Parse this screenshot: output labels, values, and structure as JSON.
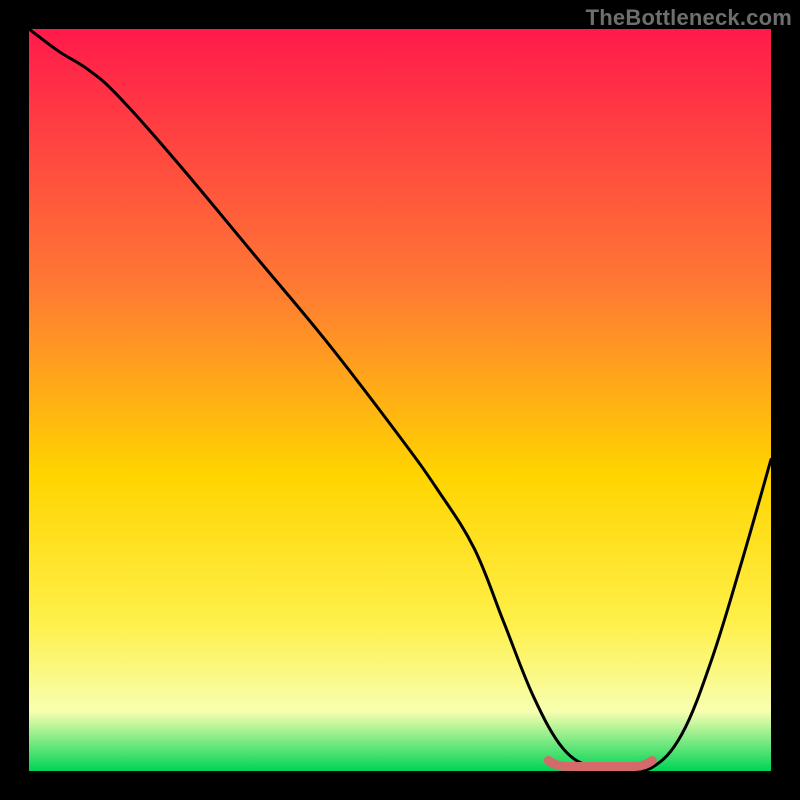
{
  "watermark": "TheBottleneck.com",
  "colors": {
    "gradient_top": "#ff1a4b",
    "gradient_mid1": "#ff7a33",
    "gradient_mid2": "#ffd400",
    "gradient_mid3": "#fff04a",
    "gradient_mid4": "#f7ffb0",
    "gradient_bottom": "#00d455",
    "curve": "#000000",
    "plateau": "#d46a6a",
    "frame": "#000000"
  },
  "chart_data": {
    "type": "line",
    "title": "",
    "xlabel": "",
    "ylabel": "",
    "xlim": [
      0,
      100
    ],
    "ylim": [
      0,
      100
    ],
    "x": [
      0,
      4,
      8,
      12,
      20,
      30,
      40,
      50,
      55,
      60,
      64,
      68,
      72,
      76,
      80,
      84,
      88,
      92,
      96,
      100
    ],
    "values": [
      100,
      97,
      94.5,
      91,
      82,
      70,
      58,
      45,
      38,
      30,
      20,
      10,
      3,
      0.5,
      0.3,
      0.5,
      5,
      15,
      28,
      42
    ],
    "plateau_x": [
      70,
      84
    ],
    "plateau_y": 0.6,
    "annotations": []
  }
}
